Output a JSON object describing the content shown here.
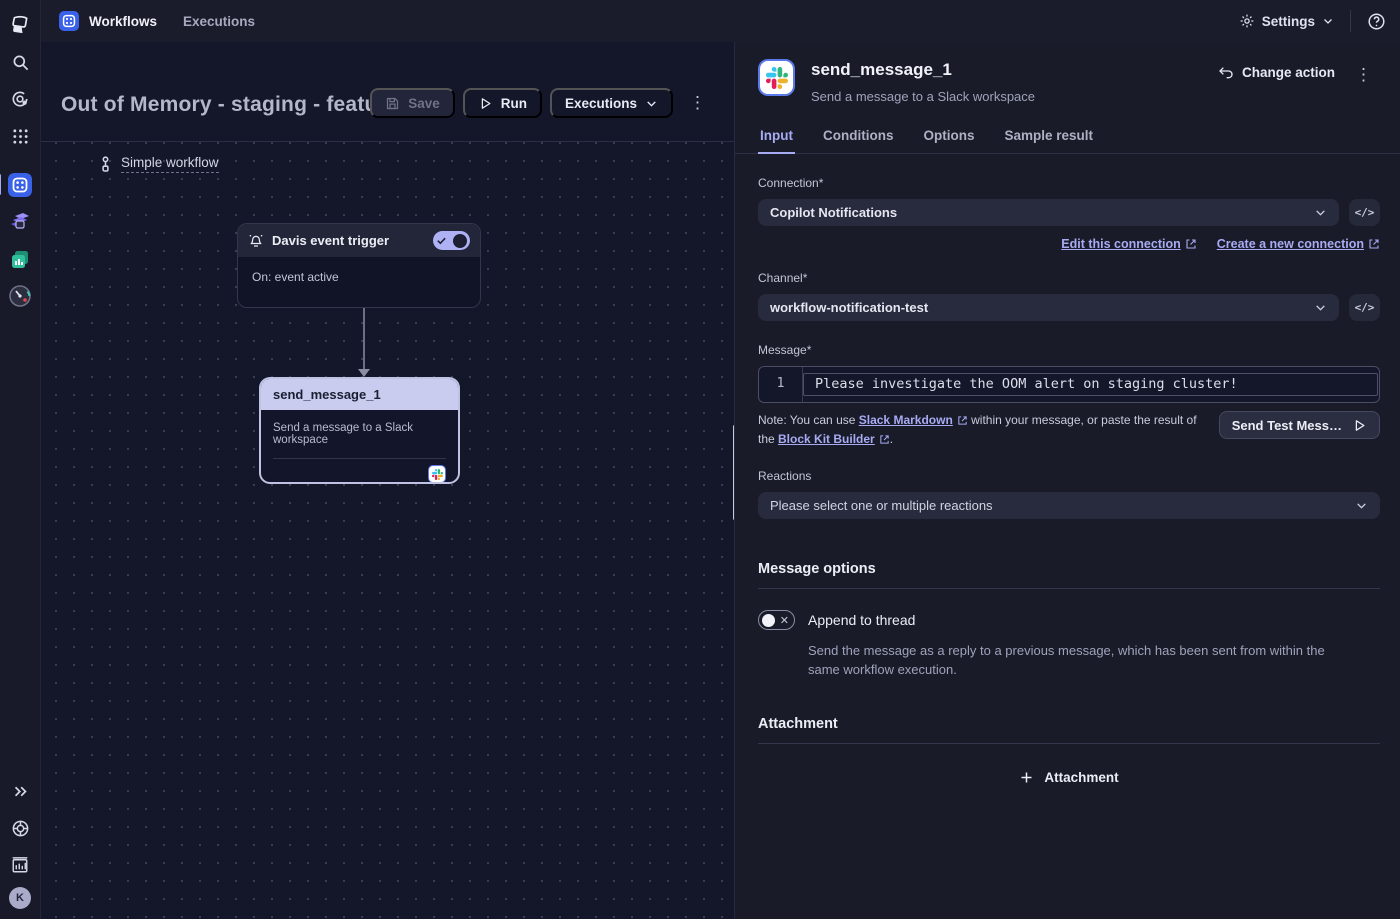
{
  "topbar": {
    "workflows_label": "Workflows",
    "executions_label": "Executions",
    "settings_label": "Settings"
  },
  "sidebar": {
    "avatar_initial": "K"
  },
  "canvas": {
    "title": "Out of Memory - staging - feature…",
    "toolbar": {
      "save_label": "Save",
      "run_label": "Run",
      "executions_label": "Executions"
    },
    "workflow_type_label": "Simple workflow",
    "nodes": {
      "trigger": {
        "title": "Davis event trigger",
        "subtitle": "On: event active"
      },
      "action": {
        "title": "send_message_1",
        "subtitle": "Send a message to a Slack workspace"
      }
    }
  },
  "panel": {
    "title": "send_message_1",
    "subtitle": "Send a message to a Slack workspace",
    "change_action_label": "Change action",
    "tabs": {
      "input": "Input",
      "conditions": "Conditions",
      "options": "Options",
      "sample_result": "Sample result"
    },
    "connection": {
      "label": "Connection*",
      "value": "Copilot Notifications",
      "edit_link": "Edit this connection",
      "create_link": "Create a new connection"
    },
    "channel": {
      "label": "Channel*",
      "value": "workflow-notification-test"
    },
    "message": {
      "label": "Message*",
      "line_number": "1",
      "value": "Please investigate the OOM alert on staging cluster!"
    },
    "note": {
      "part1": "Note: You can use ",
      "slack_markdown_link": "Slack Markdown",
      "part2": " within your message, or paste the result of the ",
      "block_kit_link": "Block Kit Builder",
      "part3": "."
    },
    "send_test_label": "Send Test Mess…",
    "reactions": {
      "label": "Reactions",
      "placeholder": "Please select one or multiple reactions"
    },
    "message_options": {
      "heading": "Message options",
      "append_label": "Append to thread",
      "append_description": "Send the message as a reply to a previous message, which has been sent from within the same workflow execution."
    },
    "attachment": {
      "heading": "Attachment",
      "add_label": "Attachment"
    }
  },
  "colors": {
    "accent_lavender": "#a8abf3",
    "app_blue": "#3a62e8",
    "slack_blue": "#36C5F0",
    "slack_green": "#2EB67D",
    "slack_yellow": "#ECB22E",
    "slack_red": "#E01E5A"
  }
}
